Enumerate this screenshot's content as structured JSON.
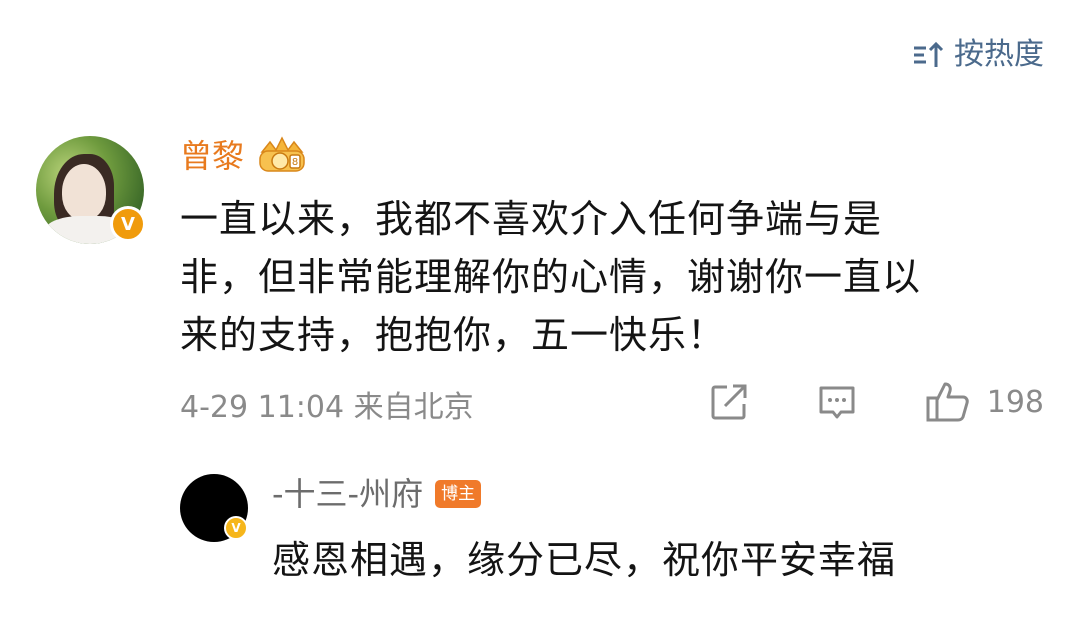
{
  "sort": {
    "label": "按热度",
    "icon": "sort-icon"
  },
  "comment": {
    "user": {
      "name": "曾黎",
      "avatar": "avatar",
      "verified_badge": "V",
      "rank_badge_icon": "crown-badge-icon"
    },
    "text_lines": [
      "一直以来，我都不喜欢介入任何争端与是",
      "非，但非常能理解你的心情，谢谢你一直以",
      "来的支持，抱抱你，五一快乐！"
    ],
    "meta": "4-29 11:04 来自北京",
    "actions": {
      "share_icon": "share-icon",
      "reply_icon": "comment-icon",
      "like_icon": "thumbs-up-icon",
      "like_count": "198"
    }
  },
  "reply": {
    "user": {
      "name": "-十三-州府",
      "tag": "博主",
      "verified_badge": "V"
    },
    "text": "感恩相遇，缘分已尽，祝你平安幸福"
  },
  "colors": {
    "accent_orange": "#e87a1e",
    "link_blue": "#4b6a8c",
    "muted_gray": "#8a8a8a",
    "verify_yellow": "#f6b61b"
  }
}
